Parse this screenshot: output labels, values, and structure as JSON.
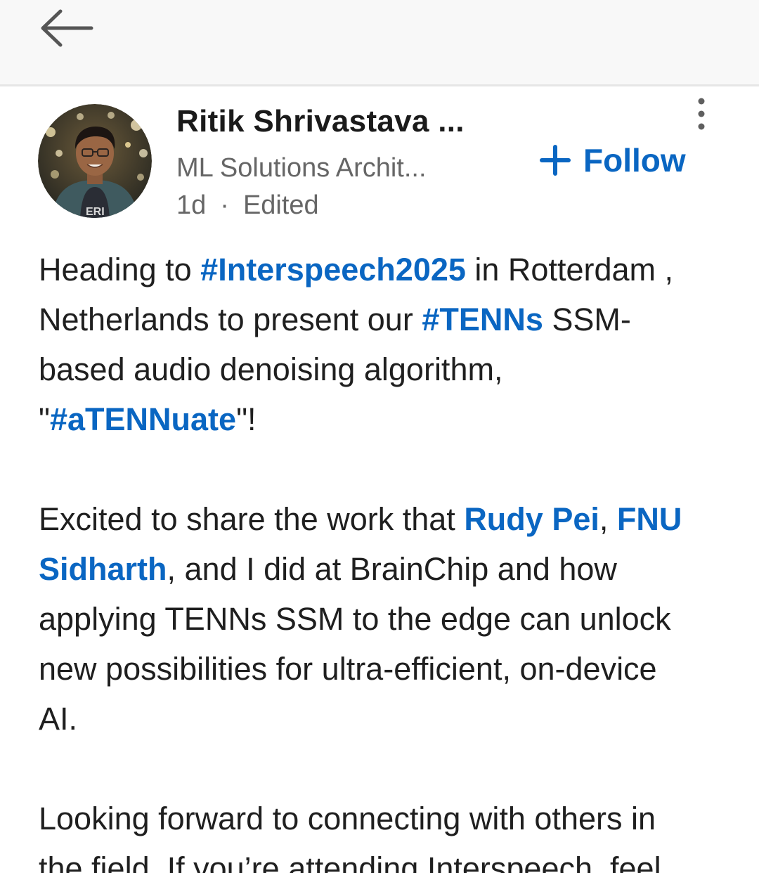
{
  "nav": {
    "back_icon": "arrow-left-icon"
  },
  "author": {
    "name": "Ritik Shrivastava ...",
    "headline": "ML Solutions Archit...",
    "time": "1d",
    "separator": "·",
    "edited": "Edited",
    "avatar_icon": "profile-photo"
  },
  "actions": {
    "follow_plus": "plus-icon",
    "follow_label": "Follow",
    "more_icon": "vertical-ellipsis-icon"
  },
  "colors": {
    "link": "#0a66c2",
    "meta_text": "#666666",
    "body_text": "#1f1f1f"
  },
  "post": {
    "p1": {
      "l1a": "Heading to ",
      "tag_interspeech": "#Interspeech2025",
      "l1b": " in Rotterdam ,",
      "l2a": "Netherlands to present our ",
      "tag_tenns": "#TENNs",
      "l2b": " SSM-",
      "l3": "based audio denoising algorithm,",
      "l4a": "\"",
      "tag_attenuate": "#aTENNuate",
      "l4b": "\"!"
    },
    "p2": {
      "l1a": "Excited to share the work that ",
      "mention_rudy": "Rudy Pei",
      "l1b": ", ",
      "mention_fnu_1": "FNU",
      "mention_fnu_2": "Sidharth",
      "l2b": ", and I did at BrainChip and how",
      "l3": "applying TENNs SSM to the edge can unlock",
      "l4": "new possibilities for ultra-efficient, on-device",
      "l5": "AI."
    },
    "p3": {
      "l1": "Looking forward to connecting with others in",
      "l2": "the field. If you’re attending Interspeech, feel"
    }
  }
}
